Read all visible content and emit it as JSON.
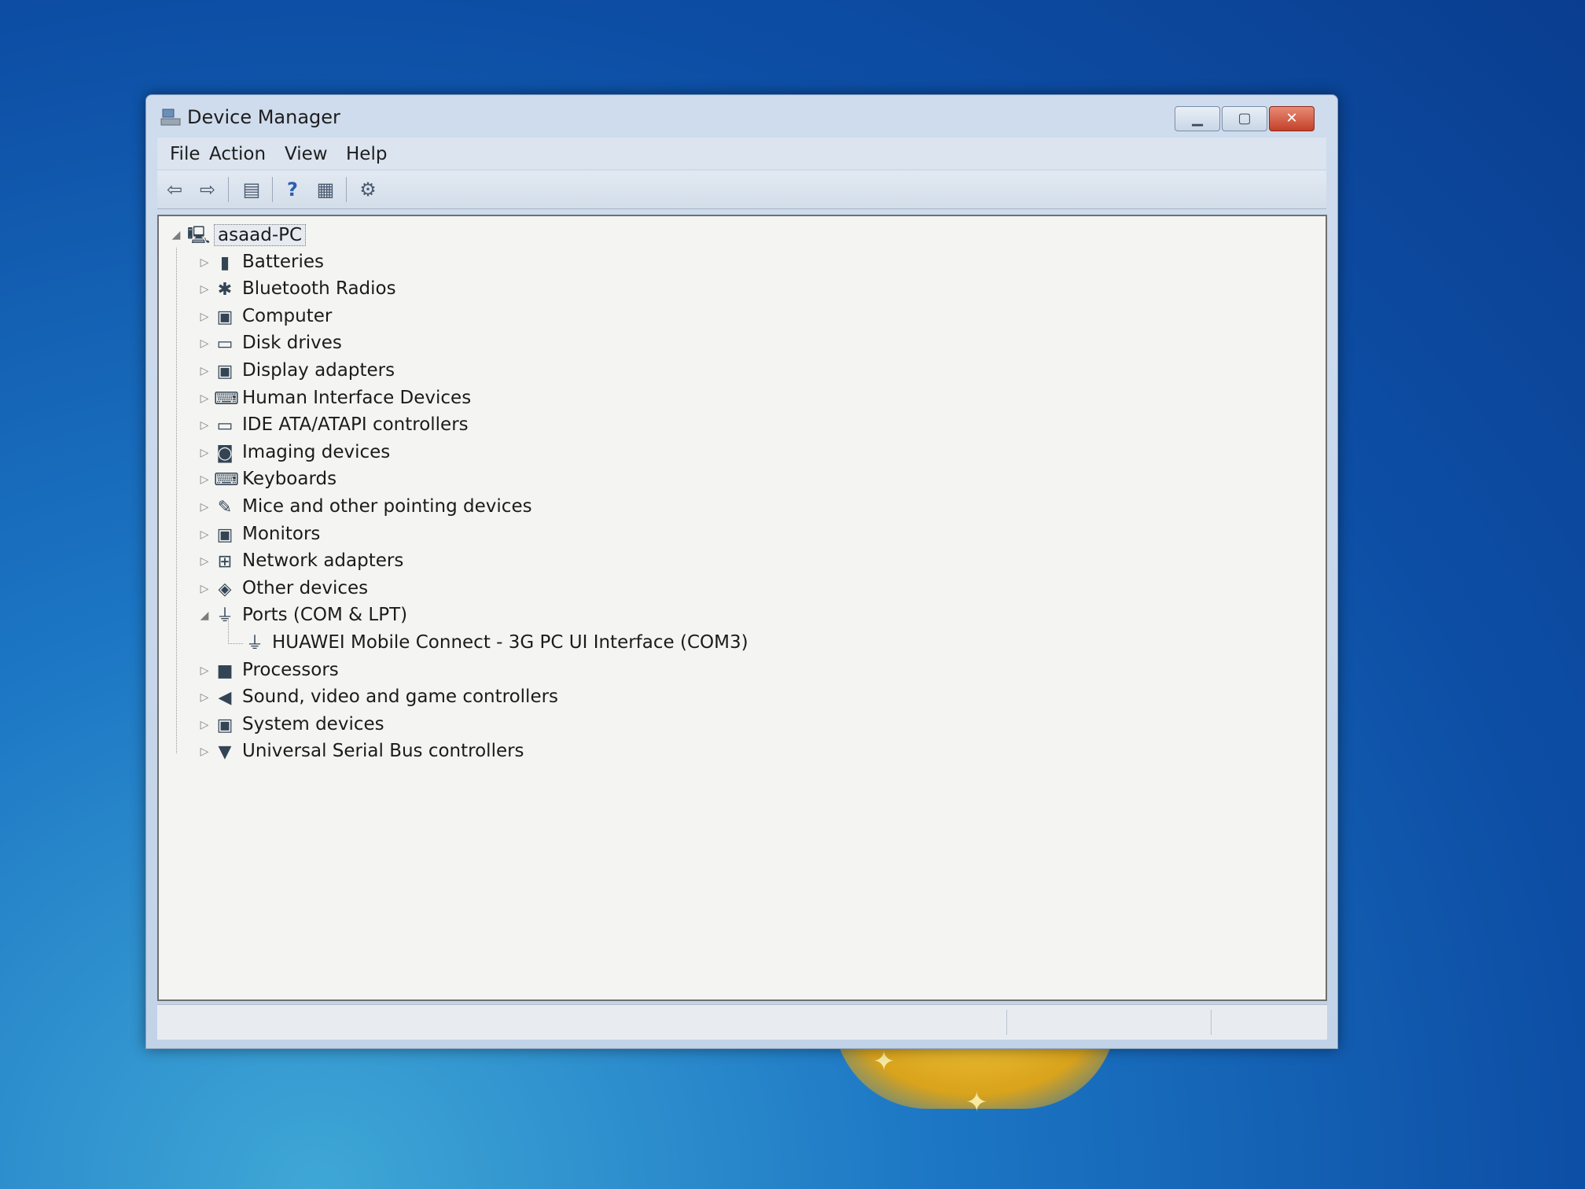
{
  "window": {
    "title": "Device Manager"
  },
  "menu": [
    "File",
    "Action",
    "View",
    "Help"
  ],
  "toolbar": [
    {
      "name": "back-arrow-icon",
      "glyph": "⇦"
    },
    {
      "name": "forward-arrow-icon",
      "glyph": "⇨"
    },
    {
      "name": "show-hide-console-tree-icon",
      "glyph": "▤"
    },
    {
      "name": "help-icon",
      "glyph": "?"
    },
    {
      "name": "properties-pane-icon",
      "glyph": "▦"
    },
    {
      "name": "scan-hardware-icon",
      "glyph": "⚙"
    }
  ],
  "tree": {
    "root": "asaad-PC",
    "categories": [
      {
        "label": "Batteries",
        "icon": "battery-icon",
        "glyph": "▮",
        "expanded": false
      },
      {
        "label": "Bluetooth Radios",
        "icon": "bluetooth-icon",
        "glyph": "✱",
        "expanded": false
      },
      {
        "label": "Computer",
        "icon": "computer-icon",
        "glyph": "▣",
        "expanded": false
      },
      {
        "label": "Disk drives",
        "icon": "disk-drive-icon",
        "glyph": "▭",
        "expanded": false
      },
      {
        "label": "Display adapters",
        "icon": "display-adapter-icon",
        "glyph": "▣",
        "expanded": false
      },
      {
        "label": "Human Interface Devices",
        "icon": "hid-icon",
        "glyph": "⌨",
        "expanded": false
      },
      {
        "label": "IDE ATA/ATAPI controllers",
        "icon": "ide-controller-icon",
        "glyph": "▭",
        "expanded": false
      },
      {
        "label": "Imaging devices",
        "icon": "imaging-device-icon",
        "glyph": "◙",
        "expanded": false
      },
      {
        "label": "Keyboards",
        "icon": "keyboard-icon",
        "glyph": "⌨",
        "expanded": false
      },
      {
        "label": "Mice and other pointing devices",
        "icon": "mouse-icon",
        "glyph": "✎",
        "expanded": false
      },
      {
        "label": "Monitors",
        "icon": "monitor-icon",
        "glyph": "▣",
        "expanded": false
      },
      {
        "label": "Network adapters",
        "icon": "network-adapter-icon",
        "glyph": "⊞",
        "expanded": false
      },
      {
        "label": "Other devices",
        "icon": "other-devices-icon",
        "glyph": "◈",
        "expanded": false
      },
      {
        "label": "Ports (COM & LPT)",
        "icon": "port-icon",
        "glyph": "⏚",
        "expanded": true,
        "children": [
          {
            "label": "HUAWEI Mobile Connect - 3G PC UI Interface (COM3)",
            "icon": "port-device-icon",
            "glyph": "⏚"
          }
        ]
      },
      {
        "label": "Processors",
        "icon": "processor-icon",
        "glyph": "■",
        "expanded": false
      },
      {
        "label": "Sound, video and game controllers",
        "icon": "speaker-icon",
        "glyph": "◀",
        "expanded": false
      },
      {
        "label": "System devices",
        "icon": "system-device-icon",
        "glyph": "▣",
        "expanded": false
      },
      {
        "label": "Universal Serial Bus controllers",
        "icon": "usb-icon",
        "glyph": "▼",
        "expanded": false
      }
    ]
  }
}
